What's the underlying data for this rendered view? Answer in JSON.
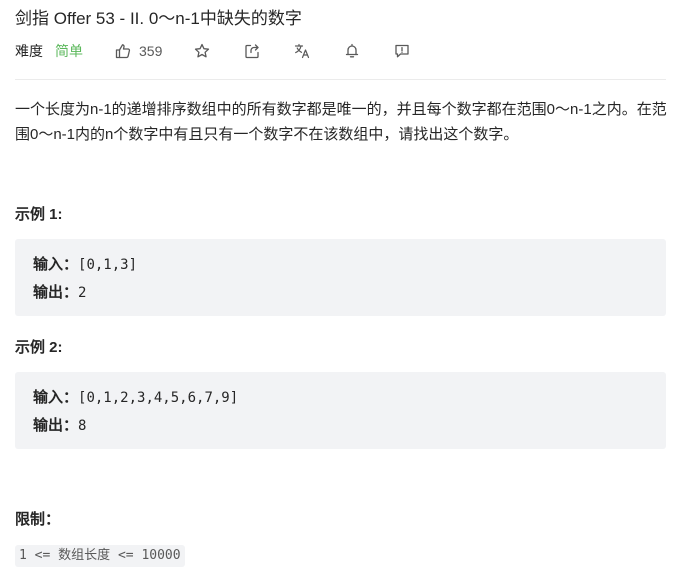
{
  "problem": {
    "title": "剑指 Offer 53 - II. 0～n-1中缺失的数字",
    "difficulty_label": "难度",
    "difficulty_value": "简单",
    "likes": "359",
    "description": "一个长度为n-1的递增排序数组中的所有数字都是唯一的，并且每个数字都在范围0～n-1之内。在范围0～n-1内的n个数字中有且只有一个数字不在该数组中，请找出这个数字。"
  },
  "icons": {
    "like": "thumbs-up-icon",
    "star": "star-icon",
    "share": "share-icon",
    "translate": "translate-icon",
    "bell": "bell-icon",
    "feedback": "feedback-icon"
  },
  "colors": {
    "easy": "#5cb85c",
    "code_bg": "#f2f3f5"
  },
  "examples": [
    {
      "title": "示例 1:",
      "input_label": "输入：",
      "input_value": "[0,1,3]",
      "output_label": "输出：",
      "output_value": "2"
    },
    {
      "title": "示例 2:",
      "input_label": "输入：",
      "input_value": "[0,1,2,3,4,5,6,7,9]",
      "output_label": "输出：",
      "output_value": "8"
    }
  ],
  "limits": {
    "title": "限制：",
    "constraint": "1 <= 数组长度 <= 10000"
  }
}
